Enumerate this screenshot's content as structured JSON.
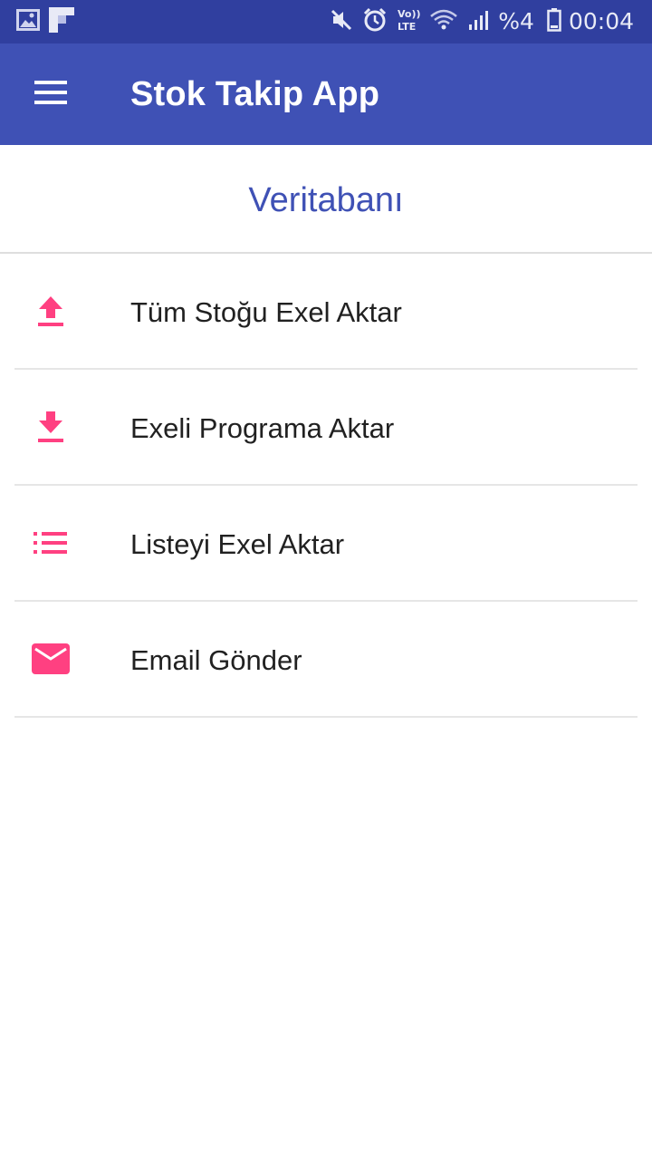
{
  "status_bar": {
    "battery_percent": "%4",
    "time": "00:04",
    "icons": [
      "image-icon",
      "flipboard-icon",
      "mute-icon",
      "alarm-icon",
      "volte-icon",
      "wifi-icon",
      "signal-icon",
      "battery-icon"
    ],
    "color": "#303F9F"
  },
  "app_bar": {
    "title": "Stok Takip App",
    "menu_icon": "hamburger-menu-icon",
    "color": "#3F51B5"
  },
  "section": {
    "title": "Veritabanı"
  },
  "menu": {
    "accent_color": "#FF4081",
    "items": [
      {
        "label": "Tüm Stoğu Exel Aktar",
        "icon": "upload-icon"
      },
      {
        "label": "Exeli Programa Aktar",
        "icon": "download-icon"
      },
      {
        "label": "Listeyi Exel Aktar",
        "icon": "list-icon"
      },
      {
        "label": "Email Gönder",
        "icon": "email-icon"
      }
    ]
  }
}
